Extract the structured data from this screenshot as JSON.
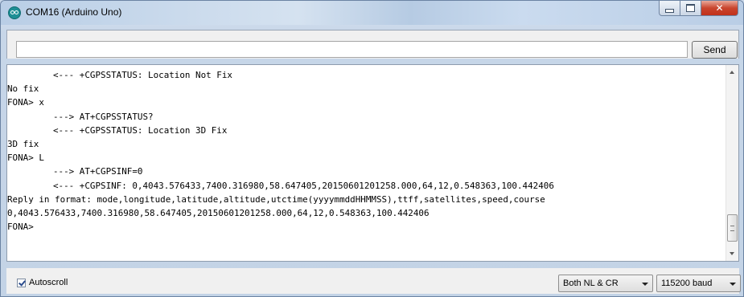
{
  "window": {
    "title": "COM16 (Arduino Uno)",
    "icon": "arduino-logo-icon",
    "controls": [
      "minimize-icon",
      "maximize-icon",
      "close-icon"
    ]
  },
  "send_bar": {
    "input_value": "",
    "send_label": "Send"
  },
  "serial_output": {
    "lines": [
      {
        "indent": true,
        "text": "<--- +CGPSSTATUS: Location Not Fix"
      },
      {
        "indent": false,
        "text": "No fix"
      },
      {
        "indent": false,
        "text": "FONA> x"
      },
      {
        "indent": true,
        "text": "---> AT+CGPSSTATUS?"
      },
      {
        "indent": true,
        "text": "<--- +CGPSSTATUS: Location 3D Fix"
      },
      {
        "indent": false,
        "text": "3D fix"
      },
      {
        "indent": false,
        "text": "FONA> L"
      },
      {
        "indent": true,
        "text": "---> AT+CGPSINF=0"
      },
      {
        "indent": true,
        "text": "<--- +CGPSINF: 0,4043.576433,7400.316980,58.647405,20150601201258.000,64,12,0.548363,100.442406"
      },
      {
        "indent": false,
        "text": "Reply in format: mode,longitude,latitude,altitude,utctime(yyyymmddHHMMSS),ttff,satellites,speed,course"
      },
      {
        "indent": false,
        "text": "0,4043.576433,7400.316980,58.647405,20150601201258.000,64,12,0.548363,100.442406"
      },
      {
        "indent": false,
        "text": "FONA>"
      }
    ]
  },
  "footer": {
    "autoscroll_label": "Autoscroll",
    "autoscroll_checked": true,
    "line_ending": "Both NL & CR",
    "baud_rate": "115200 baud"
  },
  "colors": {
    "titlebar": "#c9d8ea",
    "close_button": "#c9452e",
    "output_background": "#ffffff"
  }
}
